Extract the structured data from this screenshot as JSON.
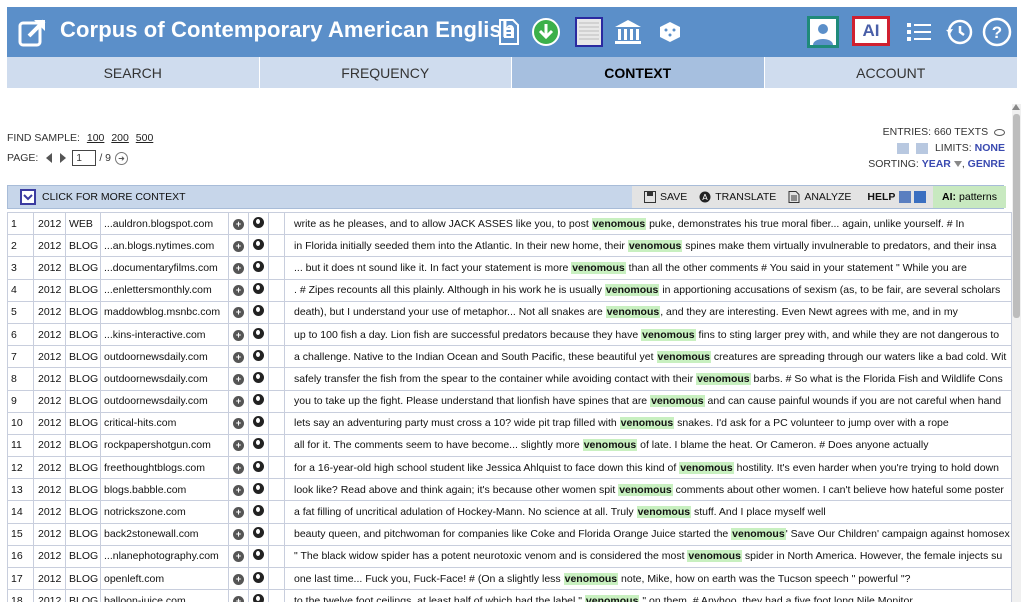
{
  "header": {
    "title": "Corpus of Contemporary American English",
    "ai_label": "AI",
    "icons": [
      "external-link-icon",
      "document-icon",
      "download-icon",
      "texture-icon",
      "museum-icon",
      "dice-icon",
      "user-icon",
      "list-icon",
      "history-icon",
      "help-icon"
    ],
    "colors": {
      "header_bg": "#5b8fc9",
      "download_green": "#3cb04a",
      "ai_border": "#d02030",
      "user_border": "#1f8a7a"
    }
  },
  "nav": {
    "tabs": [
      {
        "label": "SEARCH"
      },
      {
        "label": "FREQUENCY"
      },
      {
        "label": "CONTEXT"
      },
      {
        "label": "ACCOUNT"
      }
    ],
    "active": "CONTEXT"
  },
  "controls": {
    "find_sample_label": "FIND SAMPLE:",
    "samples": [
      "100",
      "200",
      "500"
    ],
    "page_label": "PAGE:",
    "page_value": "1",
    "page_total": "/ 9",
    "entries": "ENTRIES: 660 TEXTS",
    "limits_label": "LIMITS:",
    "limits_value": "NONE",
    "sorting_label": "SORTING:",
    "sort_primary": "YEAR",
    "sort_secondary": "GENRE"
  },
  "toolbar": {
    "context_label": "CLICK FOR MORE CONTEXT",
    "save": "SAVE",
    "translate": "TRANSLATE",
    "analyze": "ANALYZE",
    "help": "HELP",
    "ai_label": "AI:",
    "ai_value": "patterns"
  },
  "rows": [
    {
      "num": "1",
      "year": "2012",
      "genre": "WEB",
      "source": "...auldron.blogspot.com",
      "before": "write as he pleases, and to allow JACK ASSES like you, to post ",
      "kw": "venomous",
      "after": " puke, demonstrates his true moral fiber... again, unlike yourself. # In"
    },
    {
      "num": "2",
      "year": "2012",
      "genre": "BLOG",
      "source": "...an.blogs.nytimes.com",
      "before": "in Florida initially seeded them into the Atlantic. In their new home, their ",
      "kw": "venomous",
      "after": " spines make them virtually invulnerable to predators, and their insa"
    },
    {
      "num": "3",
      "year": "2012",
      "genre": "BLOG",
      "source": "...documentaryfilms.com",
      "before": "... but it does nt sound like it. In fact your statement is more ",
      "kw": "venomous",
      "after": " than all the other comments # You said in your statement \" While you are"
    },
    {
      "num": "4",
      "year": "2012",
      "genre": "BLOG",
      "source": "...enlettersmonthly.com",
      "before": ". # Zipes recounts all this plainly. Although in his work he is usually ",
      "kw": "venomous",
      "after": " in apportioning accusations of sexism (as, to be fair, are several scholars"
    },
    {
      "num": "5",
      "year": "2012",
      "genre": "BLOG",
      "source": "maddowblog.msnbc.com",
      "before": "death), but I understand your use of metaphor... Not all snakes are ",
      "kw": "venomous",
      "after": ", and they are interesting. Even Newt agrees with me, and in my"
    },
    {
      "num": "6",
      "year": "2012",
      "genre": "BLOG",
      "source": "...kins-interactive.com",
      "before": "up to 100 fish a day. Lion fish are successful predators because they have ",
      "kw": "venomous",
      "after": " fins to sting larger prey with, and while they are not dangerous to"
    },
    {
      "num": "7",
      "year": "2012",
      "genre": "BLOG",
      "source": "outdoornewsdaily.com",
      "before": "a challenge. Native to the Indian Ocean and South Pacific, these beautiful yet ",
      "kw": "venomous",
      "after": " creatures are spreading through our waters like a bad cold. Wit"
    },
    {
      "num": "8",
      "year": "2012",
      "genre": "BLOG",
      "source": "outdoornewsdaily.com",
      "before": "safely transfer the fish from the spear to the container while avoiding contact with their ",
      "kw": "venomous",
      "after": " barbs. # So what is the Florida Fish and Wildlife Cons"
    },
    {
      "num": "9",
      "year": "2012",
      "genre": "BLOG",
      "source": "outdoornewsdaily.com",
      "before": "you to take up the fight. Please understand that lionfish have spines that are ",
      "kw": "venomous",
      "after": " and can cause painful wounds if you are not careful when hand"
    },
    {
      "num": "10",
      "year": "2012",
      "genre": "BLOG",
      "source": "critical-hits.com",
      "before": "lets say an adventuring party must cross a 10? wide pit trap filled with ",
      "kw": "venomous",
      "after": " snakes. I'd ask for a PC volunteer to jump over with a rope"
    },
    {
      "num": "11",
      "year": "2012",
      "genre": "BLOG",
      "source": "rockpapershotgun.com",
      "before": "all for it. The comments seem to have become... slightly more ",
      "kw": "venomous",
      "after": " of late. I blame the heat. Or Cameron. # Does anyone actually"
    },
    {
      "num": "12",
      "year": "2012",
      "genre": "BLOG",
      "source": "freethoughtblogs.com",
      "before": "for a 16-year-old high school student like Jessica Ahlquist to face down this kind of ",
      "kw": "venomous",
      "after": " hostility. It's even harder when you're trying to hold down"
    },
    {
      "num": "13",
      "year": "2012",
      "genre": "BLOG",
      "source": "blogs.babble.com",
      "before": "look like? Read above and think again; it's because other women spit ",
      "kw": "venomous",
      "after": " comments about other women. I can't believe how hateful some poster"
    },
    {
      "num": "14",
      "year": "2012",
      "genre": "BLOG",
      "source": "notrickszone.com",
      "before": "a fat filling of uncritical adulation of Hockey-Mann. No science at all. Truly ",
      "kw": "venomous",
      "after": " stuff. And I place myself well"
    },
    {
      "num": "15",
      "year": "2012",
      "genre": "BLOG",
      "source": "back2stonewall.com",
      "before": "beauty queen, and pitchwoman for companies like Coke and Florida Orange Juice started the ",
      "kw": "venomous",
      "after": "' Save Our Children' campaign against homosex"
    },
    {
      "num": "16",
      "year": "2012",
      "genre": "BLOG",
      "source": "...nlanephotography.com",
      "before": "\" The black widow spider has a potent neurotoxic venom and is considered the most ",
      "kw": "venomous",
      "after": " spider in North America. However, the female injects su"
    },
    {
      "num": "17",
      "year": "2012",
      "genre": "BLOG",
      "source": "openleft.com",
      "before": "one last time... Fuck you, Fuck-Face! # (On a slightly less ",
      "kw": "venomous",
      "after": " note, Mike, how on earth was the Tucson speech \" powerful \"?"
    },
    {
      "num": "18",
      "year": "2012",
      "genre": "BLOG",
      "source": "balloon-juice.com",
      "before": "to the twelve foot ceilings, at least half of which had the label \" ",
      "kw": "venomous",
      "after": " \" on them. # Anyhoo, they had a five foot long Nile Monitor"
    }
  ]
}
